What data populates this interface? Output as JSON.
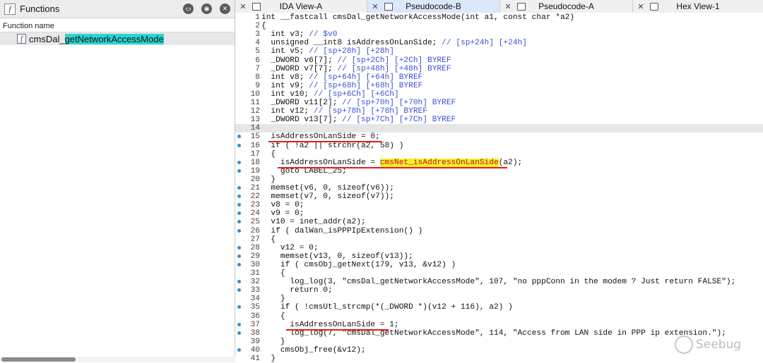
{
  "functions_panel": {
    "title": "Functions",
    "column_header": "Function name",
    "items": [
      {
        "prefix": "cmsDal_",
        "highlight": "getNetworkAccessMode"
      }
    ]
  },
  "tabs": [
    {
      "label": "IDA View-A",
      "icon": "ida-view-icon",
      "active": false
    },
    {
      "label": "Pseudocode-B",
      "icon": "pseudocode-icon",
      "active": true
    },
    {
      "label": "Pseudocode-A",
      "icon": "pseudocode-icon",
      "active": false
    },
    {
      "label": "Hex View-1",
      "icon": "hex-view-icon",
      "active": false
    }
  ],
  "code": {
    "header": "int __fastcall cmsDal_getNetworkAccessMode(int a1, const char *a2)",
    "current_line": 14,
    "lines": [
      {
        "n": "1",
        "t": "int __fastcall cmsDal_getNetworkAccessMode(int a1, const char *a2)",
        "dot": false,
        "style": "decl"
      },
      {
        "n": "2",
        "t": "{",
        "dot": false
      },
      {
        "n": "3",
        "t": "  int v3; // $v0",
        "dot": false
      },
      {
        "n": "4",
        "t": "  unsigned __int8 isAddressOnLanSide; // [sp+24h] [+24h]",
        "dot": false
      },
      {
        "n": "5",
        "t": "  int v5; // [sp+28h] [+28h]",
        "dot": false
      },
      {
        "n": "6",
        "t": "  _DWORD v6[7]; // [sp+2Ch] [+2Ch] BYREF",
        "dot": false
      },
      {
        "n": "7",
        "t": "  _DWORD v7[7]; // [sp+48h] [+48h] BYREF",
        "dot": false
      },
      {
        "n": "8",
        "t": "  int v8; // [sp+64h] [+64h] BYREF",
        "dot": false
      },
      {
        "n": "9",
        "t": "  int v9; // [sp+68h] [+68h] BYREF",
        "dot": false
      },
      {
        "n": "10",
        "t": "  int v10; // [sp+6Ch] [+6Ch]",
        "dot": false
      },
      {
        "n": "11",
        "t": "  _DWORD v11[2]; // [sp+70h] [+70h] BYREF",
        "dot": false
      },
      {
        "n": "12",
        "t": "  int v12; // [sp+78h] [+78h] BYREF",
        "dot": false
      },
      {
        "n": "13",
        "t": "  _DWORD v13[7]; // [sp+7Ch] [+7Ch] BYREF",
        "dot": false
      },
      {
        "n": "14",
        "t": "",
        "dot": false
      },
      {
        "n": "15",
        "t": "  isAddressOnLanSide = 0;",
        "dot": true
      },
      {
        "n": "16",
        "t": "  if ( !a2 || strchr(a2, 58) )",
        "dot": true
      },
      {
        "n": "17",
        "t": "  {",
        "dot": false
      },
      {
        "n": "18",
        "t": "    isAddressOnLanSide = cmsNet_isAddressOnLanSide(a2);",
        "dot": true
      },
      {
        "n": "19",
        "t": "    goto LABEL_25;",
        "dot": true
      },
      {
        "n": "20",
        "t": "  }",
        "dot": false
      },
      {
        "n": "21",
        "t": "  memset(v6, 0, sizeof(v6));",
        "dot": true
      },
      {
        "n": "22",
        "t": "  memset(v7, 0, sizeof(v7));",
        "dot": true
      },
      {
        "n": "23",
        "t": "  v8 = 0;",
        "dot": true
      },
      {
        "n": "24",
        "t": "  v9 = 0;",
        "dot": true
      },
      {
        "n": "25",
        "t": "  v10 = inet_addr(a2);",
        "dot": true
      },
      {
        "n": "26",
        "t": "  if ( dalWan_isPPPIpExtension() )",
        "dot": true
      },
      {
        "n": "27",
        "t": "  {",
        "dot": false
      },
      {
        "n": "28",
        "t": "    v12 = 0;",
        "dot": true
      },
      {
        "n": "29",
        "t": "    memset(v13, 0, sizeof(v13));",
        "dot": true
      },
      {
        "n": "30",
        "t": "    if ( cmsObj_getNext(179, v13, &v12) )",
        "dot": true
      },
      {
        "n": "31",
        "t": "    {",
        "dot": false
      },
      {
        "n": "32",
        "t": "      log_log(3, \"cmsDal_getNetworkAccessMode\", 107, \"no pppConn in the modem ? Just return FALSE\");",
        "dot": true
      },
      {
        "n": "33",
        "t": "      return 0;",
        "dot": true
      },
      {
        "n": "34",
        "t": "    }",
        "dot": false
      },
      {
        "n": "35",
        "t": "    if ( !cmsUtl_strcmp(*(_DWORD *)(v12 + 116), a2) )",
        "dot": true
      },
      {
        "n": "36",
        "t": "    {",
        "dot": false
      },
      {
        "n": "37",
        "t": "      isAddressOnLanSide = 1;",
        "dot": true
      },
      {
        "n": "38",
        "t": "      log_log(7, \"cmsDal_getNetworkAccessMode\", 114, \"Access from LAN side in PPP ip extension.\");",
        "dot": true
      },
      {
        "n": "39",
        "t": "    }",
        "dot": false
      },
      {
        "n": "40",
        "t": "    cmsObj_free(&v12);",
        "dot": true
      },
      {
        "n": "41",
        "t": "  }",
        "dot": false
      }
    ]
  },
  "watermark": "Seebug",
  "colors": {
    "accent_tab": "#dde7fa",
    "comment": "#3a4fd8",
    "highlight_bg": "#f6ee2a",
    "highlight_fg": "#c01818",
    "underline": "#e31b1b",
    "breakpoint_dot": "#3a8ad6",
    "function_highlight": "#2ad4d4"
  }
}
